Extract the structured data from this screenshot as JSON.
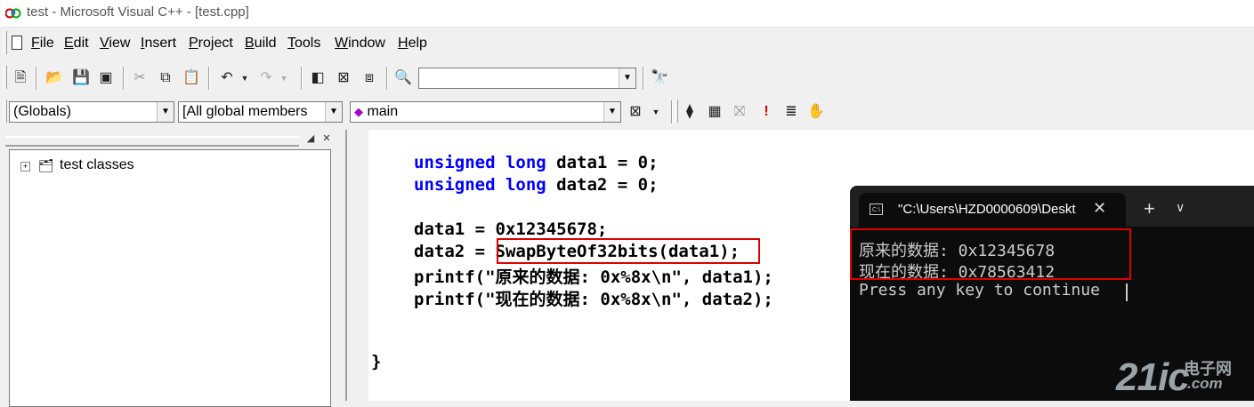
{
  "window": {
    "title": "test - Microsoft Visual C++ - [test.cpp]"
  },
  "menu": {
    "items": [
      {
        "label": "File",
        "u": "F",
        "rest": "ile"
      },
      {
        "label": "Edit",
        "u": "E",
        "rest": "dit"
      },
      {
        "label": "View",
        "u": "V",
        "rest": "iew"
      },
      {
        "label": "Insert",
        "u": "I",
        "rest": "nsert"
      },
      {
        "label": "Project",
        "u": "P",
        "rest": "roject"
      },
      {
        "label": "Build",
        "u": "B",
        "rest": "uild"
      },
      {
        "label": "Tools",
        "u": "T",
        "rest": "ools"
      },
      {
        "label": "Window",
        "u": "W",
        "rest": "indow"
      },
      {
        "label": "Help",
        "u": "H",
        "rest": "elp"
      }
    ]
  },
  "toolbar": {
    "find_combo_value": "",
    "scope_combo": "(Globals)",
    "members_combo": "[All global members",
    "function_combo": "main"
  },
  "workspace": {
    "tree_root_label": "test classes"
  },
  "editor": {
    "lines": {
      "l1_kw": "unsigned long",
      "l1_rest": " data1 = 0;",
      "l2_kw": "unsigned long",
      "l2_rest": " data2 = 0;",
      "l3": "data1 = 0x12345678;",
      "l4_pre": "data2 = ",
      "l4_call": "SwapByteOf32bits(data1)",
      "l4_post": ";",
      "l5": "printf(\"原来的数据: 0x%8x\\n\", data1);",
      "l6": "printf(\"现在的数据: 0x%8x\\n\", data2);",
      "brace": "}"
    }
  },
  "terminal": {
    "tab_title": "\"C:\\Users\\HZD0000609\\Deskt",
    "close_glyph": "✕",
    "plus_glyph": "+",
    "chevron_glyph": "∨",
    "output": [
      "原来的数据: 0x12345678",
      "现在的数据: 0x78563412",
      "Press any key to continue"
    ]
  },
  "watermark": {
    "big": "21ic",
    "cn": "电子网",
    "com": ".com"
  },
  "colors": {
    "keyword": "#0000ff",
    "highlight_box": "#dd0000",
    "terminal_bg": "#0c0c0c"
  }
}
